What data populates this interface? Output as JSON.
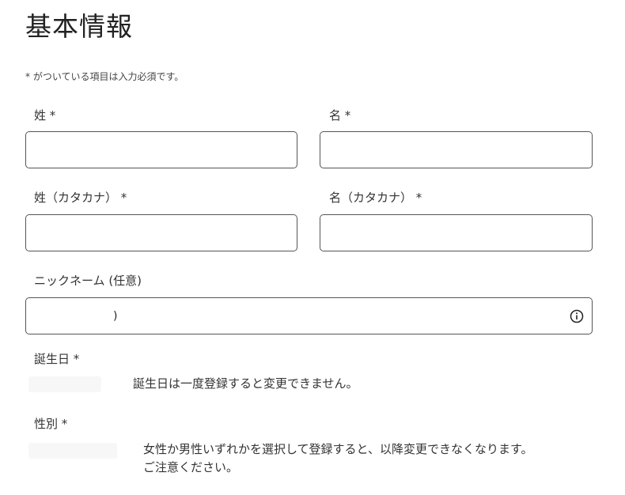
{
  "form": {
    "title": "基本情報",
    "required_note": "* がついている項目は入力必須です。",
    "last_name": {
      "label": "姓 *",
      "value": ""
    },
    "first_name": {
      "label": "名 *",
      "value": ""
    },
    "last_name_kana": {
      "label": "姓（カタカナ） *",
      "value": ""
    },
    "first_name_kana": {
      "label": "名（カタカナ） *",
      "value": ""
    },
    "nickname": {
      "label": "ニックネーム (任意)",
      "value": "",
      "caret": ")",
      "icon": "info-icon"
    },
    "birthday": {
      "label": "誕生日 *",
      "note": "誕生日は一度登録すると変更できません。"
    },
    "gender": {
      "label": "性別 *",
      "note_line1": "女性か男性いずれかを選択して登録すると、以降変更できなくなります。",
      "note_line2": "ご注意ください。"
    }
  }
}
